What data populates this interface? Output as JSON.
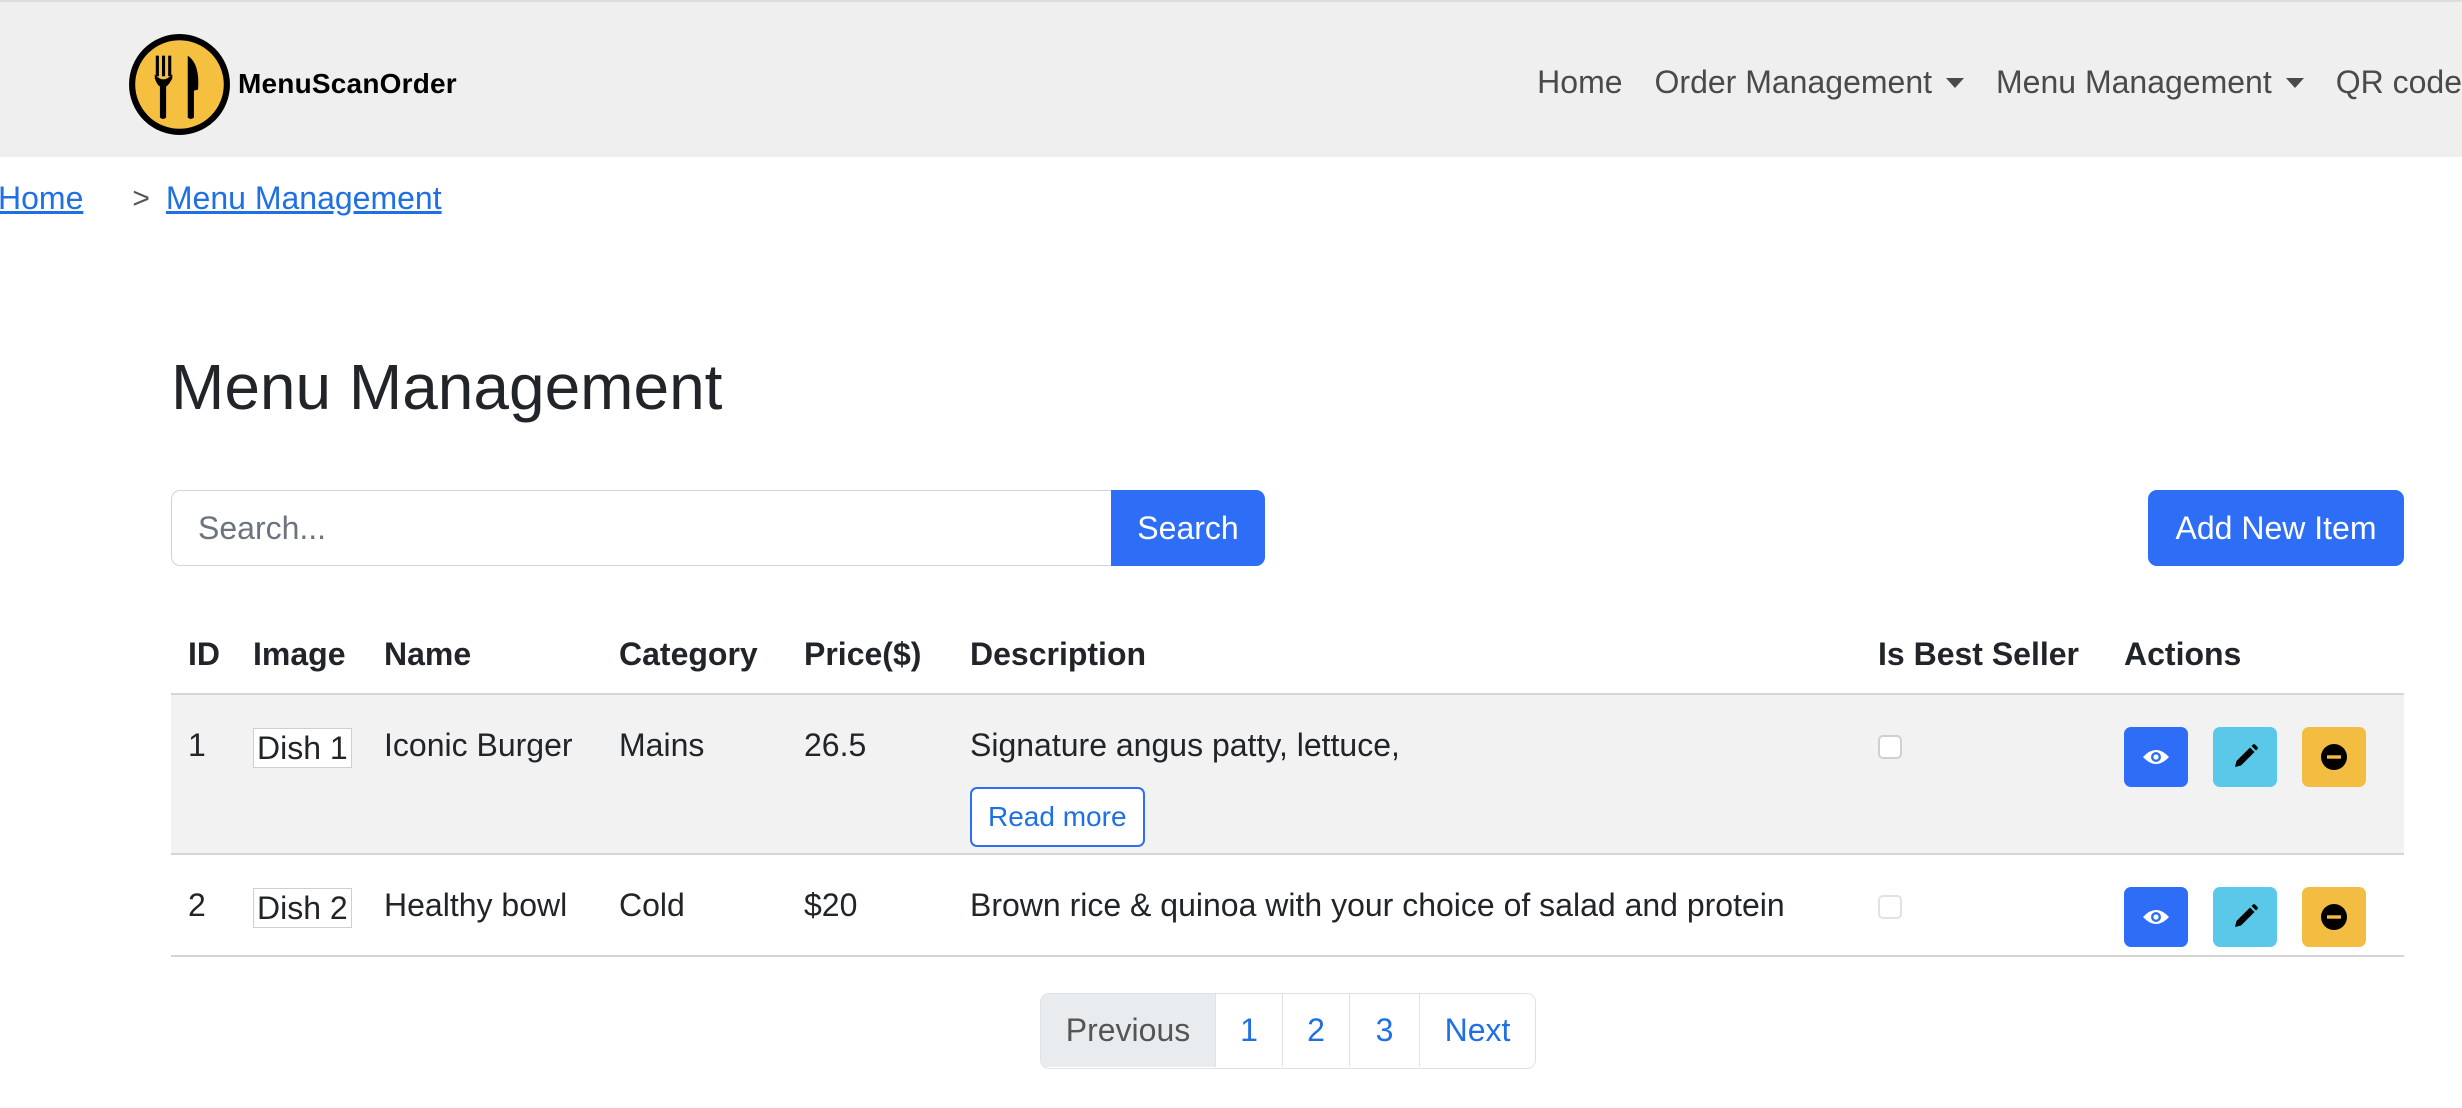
{
  "navbar": {
    "brand_name": "MenuScanOrder",
    "links": {
      "home": "Home",
      "order_management": "Order Management",
      "menu_management": "Menu Management",
      "qr_code": "QR code"
    }
  },
  "breadcrumb": {
    "home": "Home",
    "separator": ">",
    "current": "Menu Management"
  },
  "page": {
    "title": "Menu Management"
  },
  "search": {
    "placeholder": "Search...",
    "value": "",
    "button_label": "Search"
  },
  "add_button_label": "Add New Item",
  "table": {
    "headers": {
      "id": "ID",
      "image": "Image",
      "name": "Name",
      "category": "Category",
      "price": "Price($)",
      "description": "Description",
      "best_seller": "Is Best Seller",
      "actions": "Actions"
    },
    "rows": [
      {
        "id": "1",
        "image_alt": "Dish 1",
        "name": "Iconic Burger",
        "category": "Mains",
        "price": "26.5",
        "description": "Signature angus patty, lettuce,",
        "read_more": "Read more",
        "best_seller": false
      },
      {
        "id": "2",
        "image_alt": "Dish 2",
        "name": "Healthy bowl",
        "category": "Cold",
        "price": "$20",
        "description": "Brown rice & quinoa with your choice of salad and protein",
        "best_seller": false
      }
    ],
    "action_icons": [
      "eye-icon",
      "pencil-icon",
      "minus-circle-icon"
    ]
  },
  "pagination": {
    "previous": "Previous",
    "pages": [
      "1",
      "2",
      "3"
    ],
    "next": "Next"
  },
  "colors": {
    "navbar_bg": "#efefef",
    "primary": "#2e6ef7",
    "link": "#1f6fe5",
    "edit": "#5ac8e8",
    "delete": "#f3bd42",
    "logo_yellow": "#f5bf3f"
  }
}
